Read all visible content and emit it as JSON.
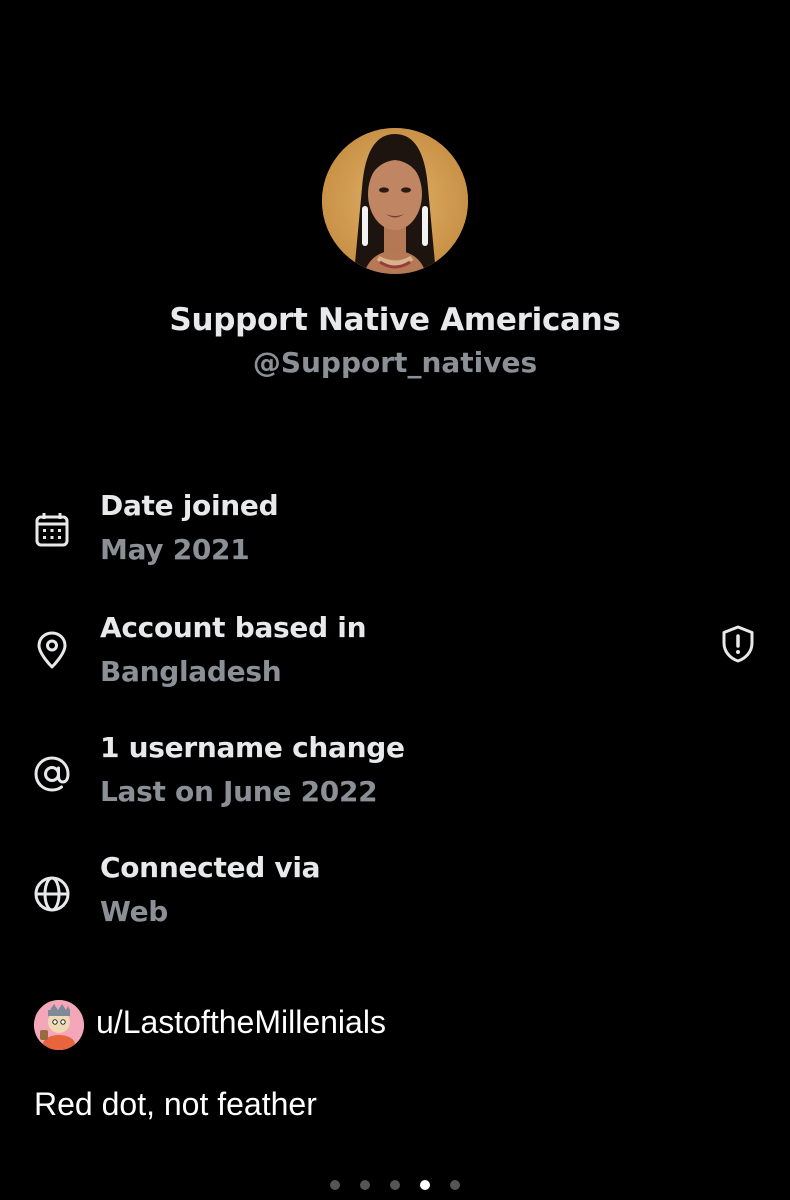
{
  "profile": {
    "avatar_icon": "profile-photo",
    "display_name": "Support Native Americans",
    "handle": "@Support_natives"
  },
  "about": [
    {
      "icon": "calendar-icon",
      "label": "Date joined",
      "value": "May 2021"
    },
    {
      "icon": "location-pin-icon",
      "label": "Account based in",
      "value": "Bangladesh",
      "trailing_icon": "shield-alert-icon"
    },
    {
      "icon": "at-sign-icon",
      "label": "1 username change",
      "value": "Last on June 2022"
    },
    {
      "icon": "globe-icon",
      "label": "Connected via",
      "value": "Web"
    }
  ],
  "post": {
    "avatar_icon": "reddit-user-avatar",
    "username": "u/LastoftheMillenials",
    "caption": "Red dot, not feather"
  },
  "carousel": {
    "total": 5,
    "active_index": 3
  },
  "colors": {
    "background": "#000000",
    "primary_text": "#e7e9ea",
    "secondary_text": "#8b9096"
  }
}
